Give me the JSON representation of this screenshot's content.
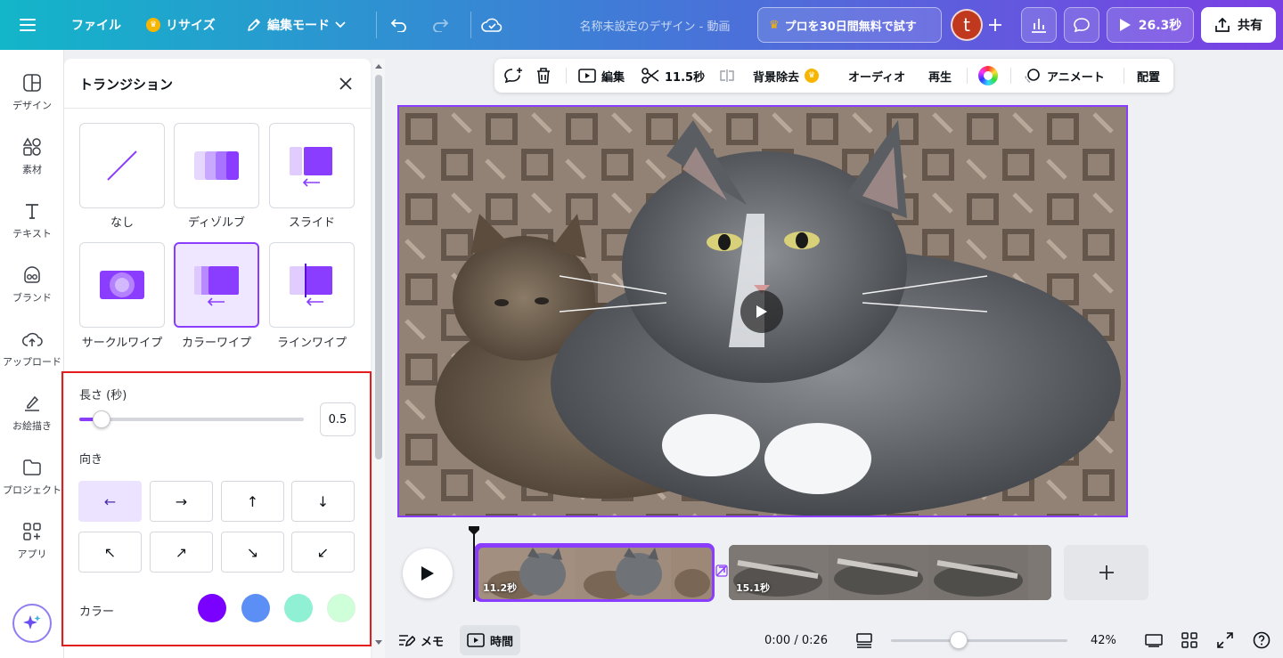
{
  "topbar": {
    "menu_icon": "hamburger-icon",
    "file_label": "ファイル",
    "resize_label": "リサイズ",
    "edit_mode_label": "編集モード",
    "doc_title": "名称未設定のデザイン - 動画",
    "pro_label": "プロを30日間無料で試す",
    "avatar_initial": "t",
    "play_time_label": "26.3秒",
    "share_label": "共有"
  },
  "sidenav": {
    "items": [
      {
        "label": "デザイン",
        "icon": "design-layout-icon"
      },
      {
        "label": "素材",
        "icon": "elements-icon"
      },
      {
        "label": "テキスト",
        "icon": "text-icon"
      },
      {
        "label": "ブランド",
        "icon": "brand-icon"
      },
      {
        "label": "アップロード",
        "icon": "upload-icon"
      },
      {
        "label": "お絵描き",
        "icon": "draw-icon"
      },
      {
        "label": "プロジェクト",
        "icon": "folder-icon"
      },
      {
        "label": "アプリ",
        "icon": "apps-icon"
      }
    ]
  },
  "panel": {
    "title": "トランジション",
    "transitions": [
      {
        "label": "なし",
        "selected": false
      },
      {
        "label": "ディゾルブ",
        "selected": false
      },
      {
        "label": "スライド",
        "selected": false
      },
      {
        "label": "サークルワイプ",
        "selected": false
      },
      {
        "label": "カラーワイプ",
        "selected": true
      },
      {
        "label": "ラインワイプ",
        "selected": false
      }
    ],
    "duration_label": "長さ (秒)",
    "duration_value": "0.5",
    "duration_fraction": 0.1,
    "direction_label": "向き",
    "directions": [
      "←",
      "→",
      "↑",
      "↓",
      "↖",
      "↗",
      "↘",
      "↙"
    ],
    "selected_direction": 0,
    "color_label": "カラー",
    "colors": [
      "#7a00ff",
      "#5b8ff5",
      "#8ff0d3",
      "#cfffd9"
    ]
  },
  "context_toolbar": {
    "edit_label": "編集",
    "trim_label": "11.5秒",
    "bg_remove_label": "背景除去",
    "audio_label": "オーディオ",
    "playback_label": "再生",
    "animate_label": "アニメート",
    "position_label": "配置"
  },
  "timeline": {
    "clip1_label": "11.2秒",
    "clip2_label": "15.1秒",
    "time_display": "0:00 / 0:26",
    "memo_label": "メモ",
    "time_label": "時間",
    "zoom_label": "42%"
  },
  "colors": {
    "accent": "#8b3dff",
    "highlight_box": "#e31c1c"
  }
}
